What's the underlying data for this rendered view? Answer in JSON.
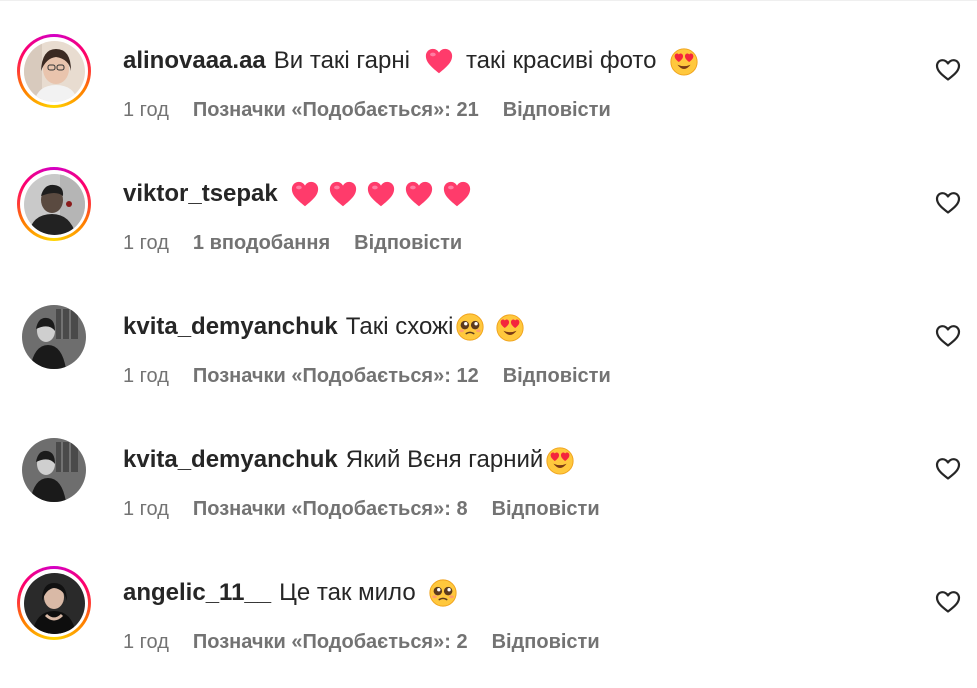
{
  "colors": {
    "text": "#262626",
    "secondary": "#737373",
    "heart": "#ff3040"
  },
  "comments": [
    {
      "username": "alinovaaa.aa",
      "text": "Ви такі гарні",
      "emojis_after_text": [
        "heart-emoji",
        "smiling-heart-eyes-emoji"
      ],
      "extra_text": "такі красиві фото",
      "time": "1 год",
      "likes": "Позначки «Подобається»: 21",
      "reply": "Відповісти",
      "story_ring": true
    },
    {
      "username": "viktor_tsepak",
      "text": "",
      "emojis": [
        "heart-emoji",
        "heart-emoji",
        "heart-emoji",
        "heart-emoji",
        "heart-emoji"
      ],
      "time": "1 год",
      "likes": "1 вподобання",
      "reply": "Відповісти",
      "story_ring": true
    },
    {
      "username": "kvita_demyanchuk",
      "text": "Такі схожі",
      "emojis": [
        "pleading-face-emoji",
        "smiling-heart-eyes-emoji"
      ],
      "time": "1 год",
      "likes": "Позначки «Подобається»: 12",
      "reply": "Відповісти",
      "story_ring": false
    },
    {
      "username": "kvita_demyanchuk",
      "text": "Який Вєня гарний",
      "emojis": [
        "smiling-heart-eyes-emoji"
      ],
      "time": "1 год",
      "likes": "Позначки «Подобається»: 8",
      "reply": "Відповісти",
      "story_ring": false
    },
    {
      "username": "angelic_11__",
      "text": "Це так мило",
      "emojis": [
        "pleading-face-emoji"
      ],
      "time": "1 год",
      "likes": "Позначки «Подобається»: 2",
      "reply": "Відповісти",
      "story_ring": true
    }
  ]
}
